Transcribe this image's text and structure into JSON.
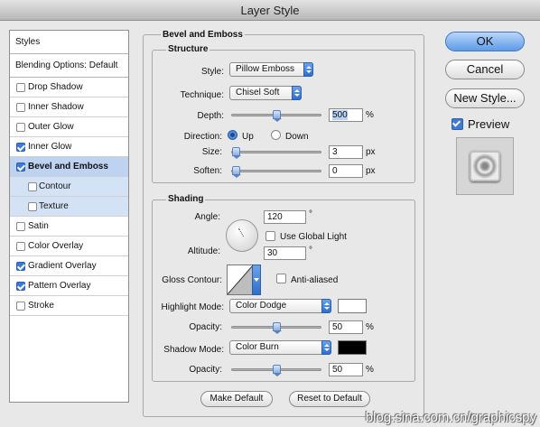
{
  "window": {
    "title": "Layer Style"
  },
  "sidebar": {
    "styles_header": "Styles",
    "blending_options": "Blending Options: Default",
    "items": [
      {
        "label": "Drop Shadow",
        "checked": false,
        "selected": false,
        "sub": false
      },
      {
        "label": "Inner Shadow",
        "checked": false,
        "selected": false,
        "sub": false
      },
      {
        "label": "Outer Glow",
        "checked": false,
        "selected": false,
        "sub": false
      },
      {
        "label": "Inner Glow",
        "checked": true,
        "selected": false,
        "sub": false
      },
      {
        "label": "Bevel and Emboss",
        "checked": true,
        "selected": true,
        "sub": false
      },
      {
        "label": "Contour",
        "checked": false,
        "selected": false,
        "sub": true
      },
      {
        "label": "Texture",
        "checked": false,
        "selected": false,
        "sub": true
      },
      {
        "label": "Satin",
        "checked": false,
        "selected": false,
        "sub": false
      },
      {
        "label": "Color Overlay",
        "checked": false,
        "selected": false,
        "sub": false
      },
      {
        "label": "Gradient Overlay",
        "checked": true,
        "selected": false,
        "sub": false
      },
      {
        "label": "Pattern Overlay",
        "checked": true,
        "selected": false,
        "sub": false
      },
      {
        "label": "Stroke",
        "checked": false,
        "selected": false,
        "sub": false
      }
    ]
  },
  "main": {
    "section_title": "Bevel and Emboss",
    "structure": {
      "title": "Structure",
      "style_label": "Style:",
      "style_value": "Pillow Emboss",
      "technique_label": "Technique:",
      "technique_value": "Chisel Soft",
      "depth_label": "Depth:",
      "depth_value": "500",
      "depth_unit": "%",
      "depth_slider_fraction": 0.5,
      "direction_label": "Direction:",
      "direction_up": "Up",
      "direction_down": "Down",
      "size_label": "Size:",
      "size_value": "3",
      "size_unit": "px",
      "size_slider_fraction": 0.0,
      "soften_label": "Soften:",
      "soften_value": "0",
      "soften_unit": "px",
      "soften_slider_fraction": 0.0
    },
    "shading": {
      "title": "Shading",
      "angle_label": "Angle:",
      "angle_value": "120",
      "angle_unit": "°",
      "global_light_label": "Use Global Light",
      "altitude_label": "Altitude:",
      "altitude_value": "30",
      "altitude_unit": "°",
      "gloss_contour_label": "Gloss Contour:",
      "anti_aliased_label": "Anti-aliased",
      "highlight_mode_label": "Highlight Mode:",
      "highlight_mode_value": "Color Dodge",
      "highlight_color": "#ffffff",
      "highlight_opacity_label": "Opacity:",
      "highlight_opacity_value": "50",
      "highlight_opacity_unit": "%",
      "highlight_opacity_fraction": 0.5,
      "shadow_mode_label": "Shadow Mode:",
      "shadow_mode_value": "Color Burn",
      "shadow_color": "#000000",
      "shadow_opacity_label": "Opacity:",
      "shadow_opacity_value": "50",
      "shadow_opacity_unit": "%",
      "shadow_opacity_fraction": 0.5
    },
    "make_default": "Make Default",
    "reset_default": "Reset to Default"
  },
  "buttons": {
    "ok": "OK",
    "cancel": "Cancel",
    "new_style": "New Style...",
    "preview": "Preview",
    "preview_checked": true
  },
  "watermark": "blog.sina.com.cn/graphicspy"
}
